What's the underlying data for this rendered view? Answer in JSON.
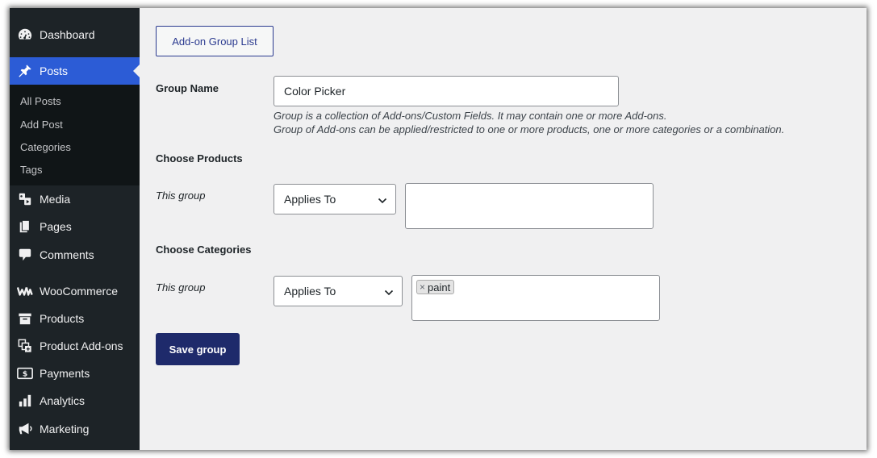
{
  "sidebar": {
    "items": [
      {
        "label": "Dashboard",
        "icon": "dashboard-icon"
      },
      {
        "label": "Posts",
        "icon": "pin-icon",
        "active": true
      },
      {
        "label": "Media",
        "icon": "media-icon"
      },
      {
        "label": "Pages",
        "icon": "pages-icon"
      },
      {
        "label": "Comments",
        "icon": "comments-icon"
      },
      {
        "label": "WooCommerce",
        "icon": "woocommerce-icon"
      },
      {
        "label": "Products",
        "icon": "products-icon"
      },
      {
        "label": "Product Add-ons",
        "icon": "product-addons-icon"
      },
      {
        "label": "Payments",
        "icon": "payments-icon"
      },
      {
        "label": "Analytics",
        "icon": "analytics-icon"
      },
      {
        "label": "Marketing",
        "icon": "marketing-icon"
      }
    ],
    "submenu": [
      "All Posts",
      "Add Post",
      "Categories",
      "Tags"
    ]
  },
  "main": {
    "group_list_button": "Add-on Group List",
    "group_name_label": "Group Name",
    "group_name_value": "Color Picker",
    "description_line1": "Group is a collection of Add-ons/Custom Fields. It may contain one or more Add-ons.",
    "description_line2": "Group of Add-ons can be applied/restricted to one or more products, one or more categories or a combination.",
    "choose_products": {
      "heading": "Choose Products",
      "row_label": "This group",
      "select_value": "Applies To"
    },
    "choose_categories": {
      "heading": "Choose Categories",
      "row_label": "This group",
      "select_value": "Applies To",
      "tags": [
        "paint"
      ]
    },
    "save_button": "Save group"
  },
  "colors": {
    "sidebar_bg": "#1d2327",
    "submenu_bg": "#101517",
    "active_item": "#2c5cd6",
    "primary_button": "#1e2a6b",
    "outline_button_border": "#2b3a8f",
    "page_bg": "#f0f0f1"
  }
}
